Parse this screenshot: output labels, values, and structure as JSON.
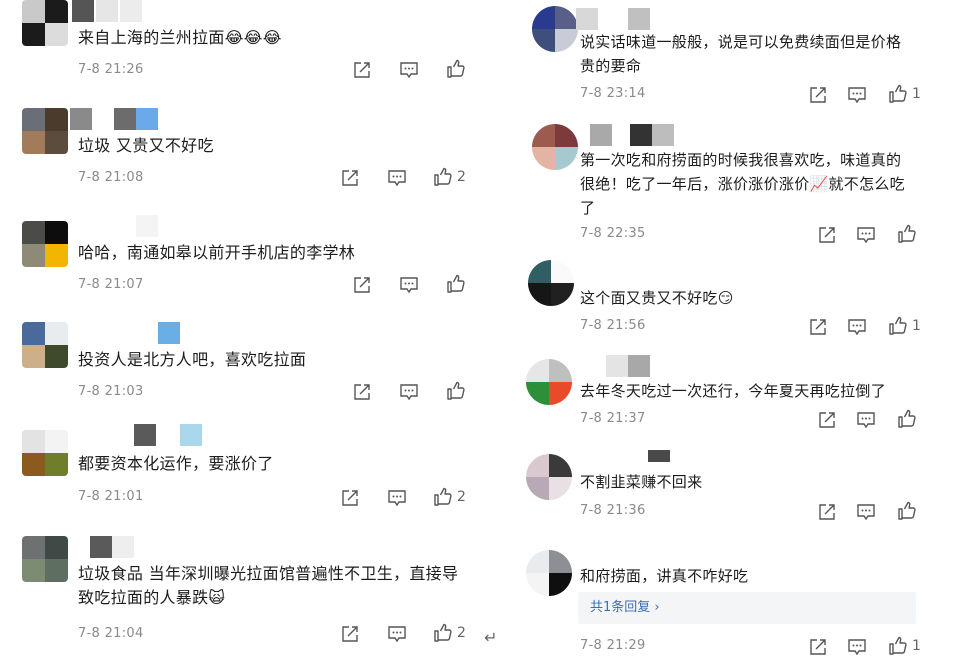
{
  "left_comments": [
    {
      "text": "来自上海的兰州拉面😂😂😂",
      "time": "7-8 21:26",
      "likes": ""
    },
    {
      "text": "垃圾 又贵又不好吃",
      "time": "7-8 21:08",
      "likes": "2"
    },
    {
      "text": "哈哈，南通如皋以前开手机店的李学林",
      "time": "7-8 21:07",
      "likes": ""
    },
    {
      "text": "投资人是北方人吧，喜欢吃拉面",
      "time": "7-8 21:03",
      "likes": ""
    },
    {
      "text": "都要资本化运作，要涨价了",
      "time": "7-8 21:01",
      "likes": "2"
    },
    {
      "text": "垃圾食品 当年深圳曝光拉面馆普遍性不卫生，直接导致吃拉面的人暴跌🙀",
      "time": "7-8 21:04",
      "likes": "2"
    }
  ],
  "right_comments": [
    {
      "text": "说实话味道一般般，说是可以免费续面但是价格贵的要命",
      "time": "7-8 23:14",
      "likes": "1"
    },
    {
      "text": "第一次吃和府捞面的时候我很喜欢吃，味道真的很绝！吃了一年后，涨价涨价涨价📈就不怎么吃了",
      "time": "7-8 22:35",
      "likes": ""
    },
    {
      "text": "这个面又贵又不好吃😏",
      "time": "7-8 21:56",
      "likes": "1"
    },
    {
      "text": "去年冬天吃过一次还行，今年夏天再吃拉倒了",
      "time": "7-8 21:37",
      "likes": ""
    },
    {
      "text": "不割韭菜赚不回来",
      "time": "7-8 21:36",
      "likes": ""
    },
    {
      "text": "和府捞面，讲真不咋好吃",
      "time": "7-8 21:29",
      "likes": "1",
      "reply": "共1条回复 ›"
    }
  ],
  "icons": {
    "forward": "forward-icon",
    "comment": "comment-icon",
    "like": "like-icon"
  },
  "stray": {
    "back_arrow": "↵"
  }
}
